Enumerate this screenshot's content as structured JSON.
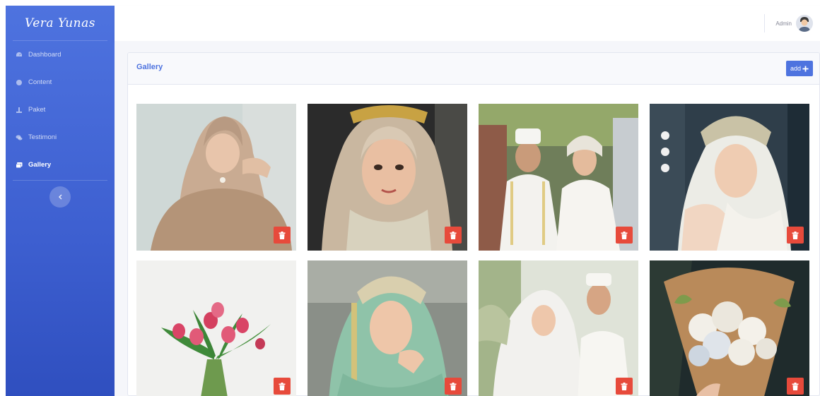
{
  "brand": {
    "logo_text": "Vera Yunas"
  },
  "sidebar": {
    "items": [
      {
        "label": "Dashboard",
        "icon": "dashboard-icon",
        "active": false
      },
      {
        "label": "Content",
        "icon": "content-icon",
        "active": false
      },
      {
        "label": "Paket",
        "icon": "package-icon",
        "active": false
      },
      {
        "label": "Testimoni",
        "icon": "comments-icon",
        "active": false
      },
      {
        "label": "Gallery",
        "icon": "images-icon",
        "active": true
      }
    ],
    "toggle_icon": "chevron-left-icon"
  },
  "topbar": {
    "user_name": "Admin",
    "avatar_icon": "user-avatar"
  },
  "gallery": {
    "title": "Gallery",
    "add_label": "add",
    "add_icon": "plus-icon",
    "photos": [
      {
        "subject": "bride in gold lace hijab",
        "delete_icon": "trash-icon"
      },
      {
        "subject": "bride with beige veil and gold crown",
        "delete_icon": "trash-icon"
      },
      {
        "subject": "couple in white wedding attire",
        "delete_icon": "trash-icon"
      },
      {
        "subject": "bride in white with silver crown",
        "delete_icon": "trash-icon"
      },
      {
        "subject": "pink tulips bouquet",
        "delete_icon": "trash-icon"
      },
      {
        "subject": "bride in mint green kebaya",
        "delete_icon": "trash-icon"
      },
      {
        "subject": "couple in white outdoor",
        "delete_icon": "trash-icon"
      },
      {
        "subject": "white roses bouquet",
        "delete_icon": "trash-icon"
      }
    ]
  },
  "colors": {
    "primary": "#4e73df",
    "danger": "#e74a3b",
    "sidebar_top": "#4e73df",
    "sidebar_bottom": "#2f4fbf"
  }
}
